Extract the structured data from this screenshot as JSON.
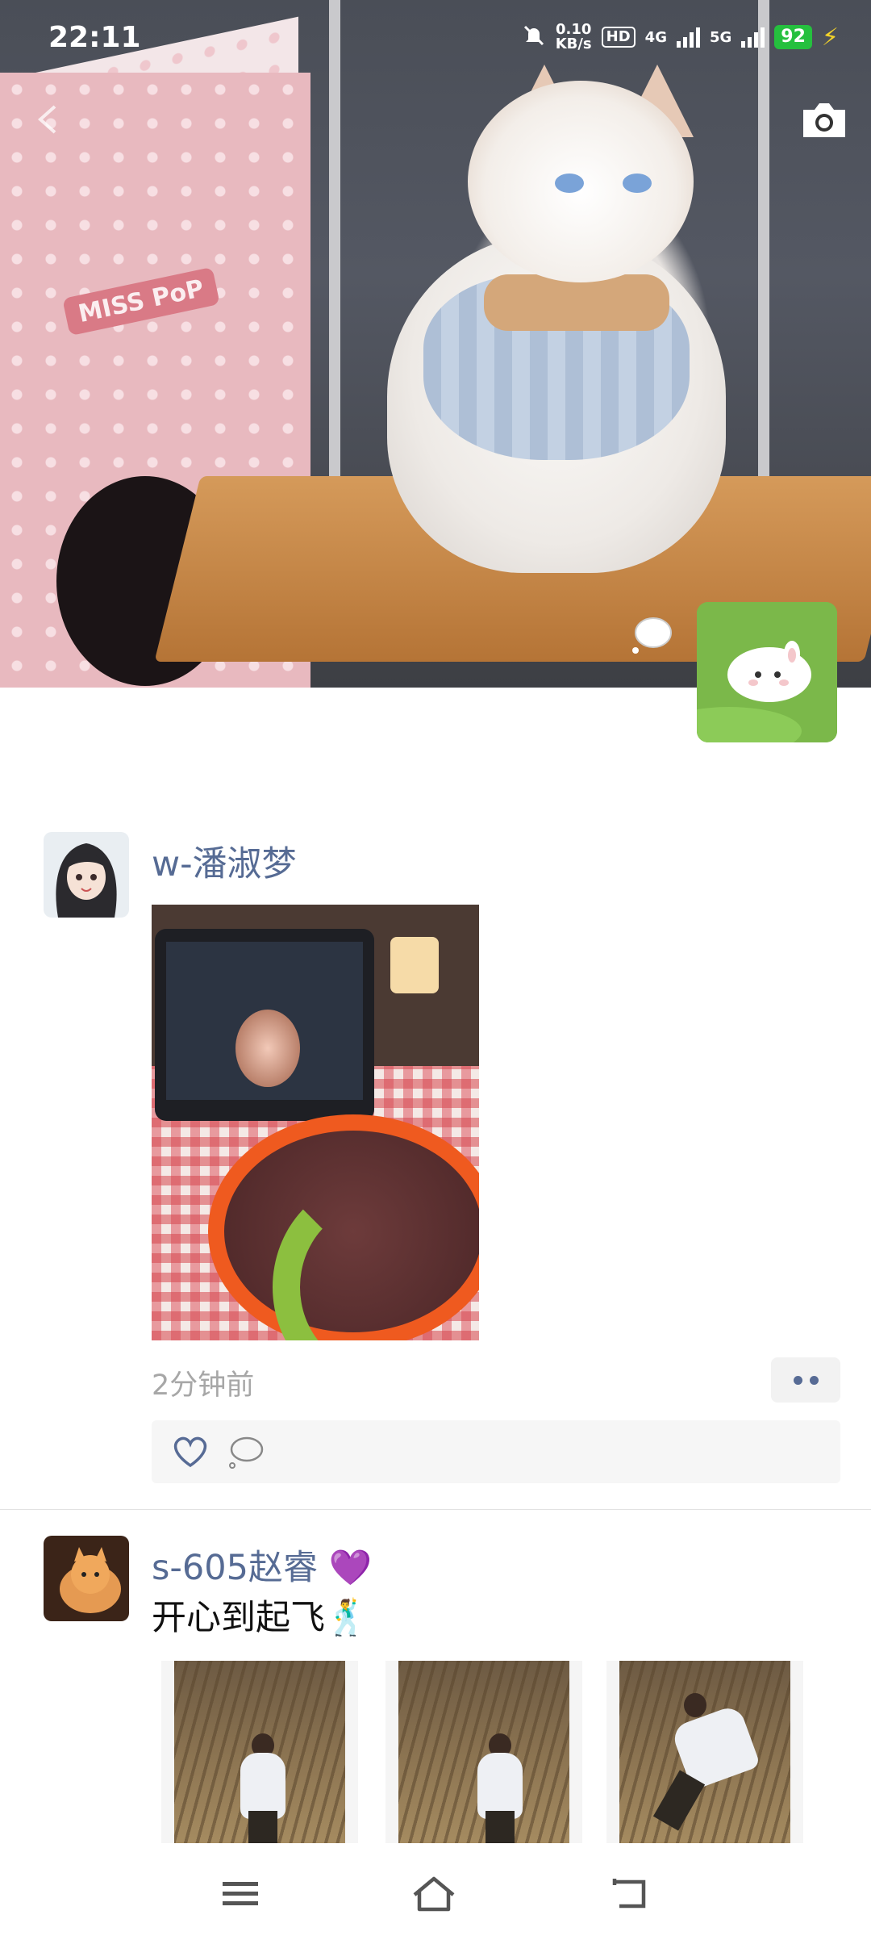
{
  "status_bar": {
    "time": "22:11",
    "net_speed": "0.10",
    "net_unit": "KB/s",
    "hd_tag": "HD",
    "sim1": "4G",
    "sim2": "5G",
    "battery": "92"
  },
  "cover": {
    "icons": [
      "back-arrow-icon",
      "camera-icon",
      "thought-bubble-icon"
    ],
    "photo_label": "MISS PoP"
  },
  "feed": {
    "posts": [
      {
        "username": "w-潘淑梦",
        "time_ago": "2分钟前"
      },
      {
        "username": "s-605赵睿",
        "badge": "💜",
        "text": "开心到起飞",
        "emoji": "🕺"
      }
    ]
  },
  "navbar": {
    "icons": [
      "menu-icon",
      "home-icon",
      "back-icon"
    ]
  },
  "colors": {
    "link_name": "#566b94",
    "time_gray": "#a7a7a7",
    "battery_green": "#25c03e"
  }
}
